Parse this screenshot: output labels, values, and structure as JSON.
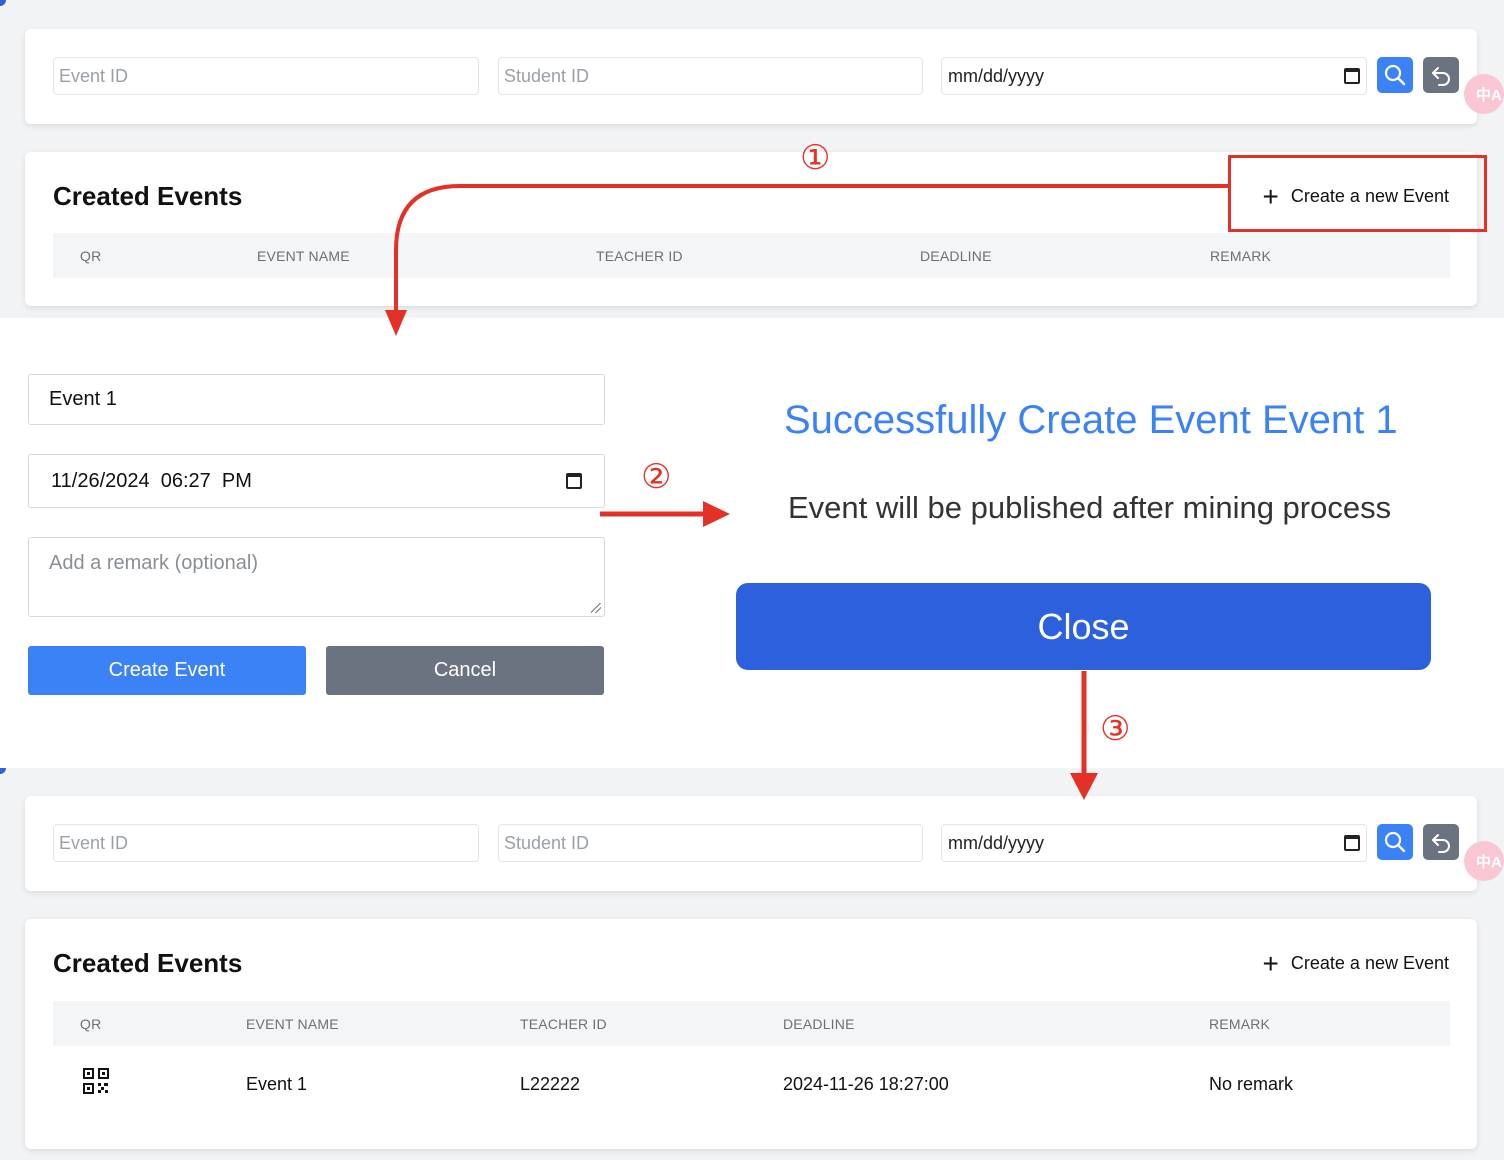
{
  "screen_before": {
    "filters": {
      "event_id_placeholder": "Event ID",
      "student_id_placeholder": "Student ID",
      "date_placeholder": "mm/dd/yyyy"
    },
    "events": {
      "title": "Created Events",
      "create_label": "Create a new Event",
      "columns": [
        "QR",
        "EVENT NAME",
        "TEACHER ID",
        "DEADLINE",
        "REMARK"
      ]
    }
  },
  "form": {
    "event_name_value": "Event 1",
    "deadline_value": "11/26/2024  06:27  PM",
    "remark_placeholder": "Add a remark (optional)",
    "create_button": "Create Event",
    "cancel_button": "Cancel"
  },
  "success": {
    "title": "Successfully Create Event Event 1",
    "message": "Event will be published after mining process",
    "close_button": "Close"
  },
  "screen_after": {
    "filters": {
      "event_id_placeholder": "Event ID",
      "student_id_placeholder": "Student ID",
      "date_placeholder": "mm/dd/yyyy"
    },
    "events": {
      "title": "Created Events",
      "create_label": "Create a new Event",
      "columns": [
        "QR",
        "EVENT NAME",
        "TEACHER ID",
        "DEADLINE",
        "REMARK"
      ],
      "rows": [
        {
          "event_name": "Event 1",
          "teacher_id": "L22222",
          "deadline": "2024-11-26 18:27:00",
          "remark": "No remark"
        }
      ]
    }
  },
  "steps": [
    "①",
    "②",
    "③"
  ],
  "colors": {
    "primary": "#3b82f6",
    "close_button": "#2c60dc",
    "secondary": "#6b7280",
    "annotation": "#e33127"
  }
}
